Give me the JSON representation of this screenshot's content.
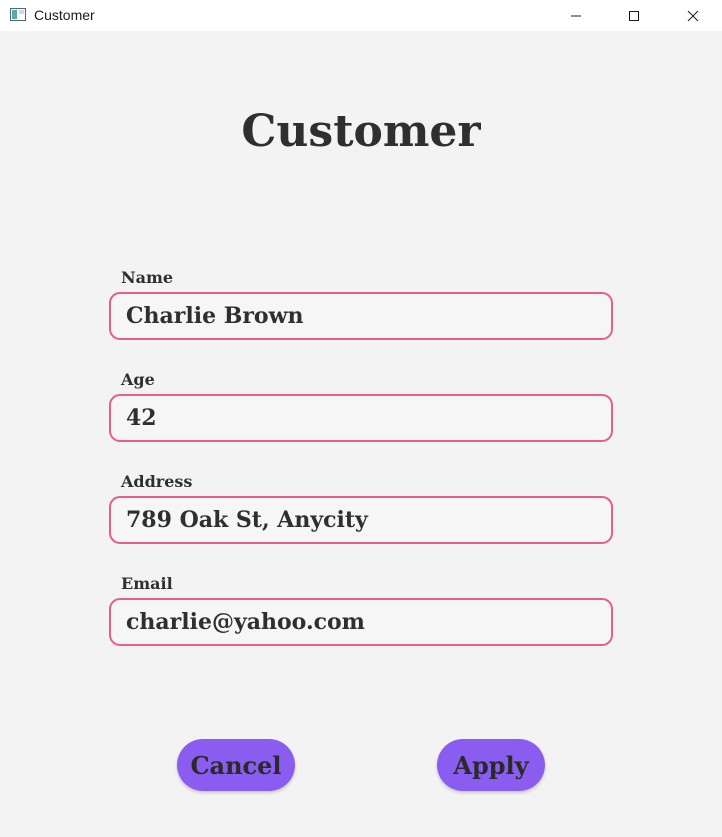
{
  "window": {
    "title": "Customer",
    "icon": "app-window-icon",
    "controls": [
      "minimize-icon",
      "maximize-icon",
      "close-icon"
    ]
  },
  "form": {
    "heading": "Customer",
    "fields": [
      {
        "label": "Name",
        "value": "Charlie Brown"
      },
      {
        "label": "Age",
        "value": "42"
      },
      {
        "label": "Address",
        "value": "789 Oak St, Anycity"
      },
      {
        "label": "Email",
        "value": "charlie@yahoo.com"
      }
    ]
  },
  "actions": {
    "cancel_label": "Cancel",
    "apply_label": "Apply"
  },
  "colors": {
    "background": "#f3f3f3",
    "input_border": "#e85d8a",
    "button": "#8b5cf0",
    "text": "#2f2f2f"
  }
}
